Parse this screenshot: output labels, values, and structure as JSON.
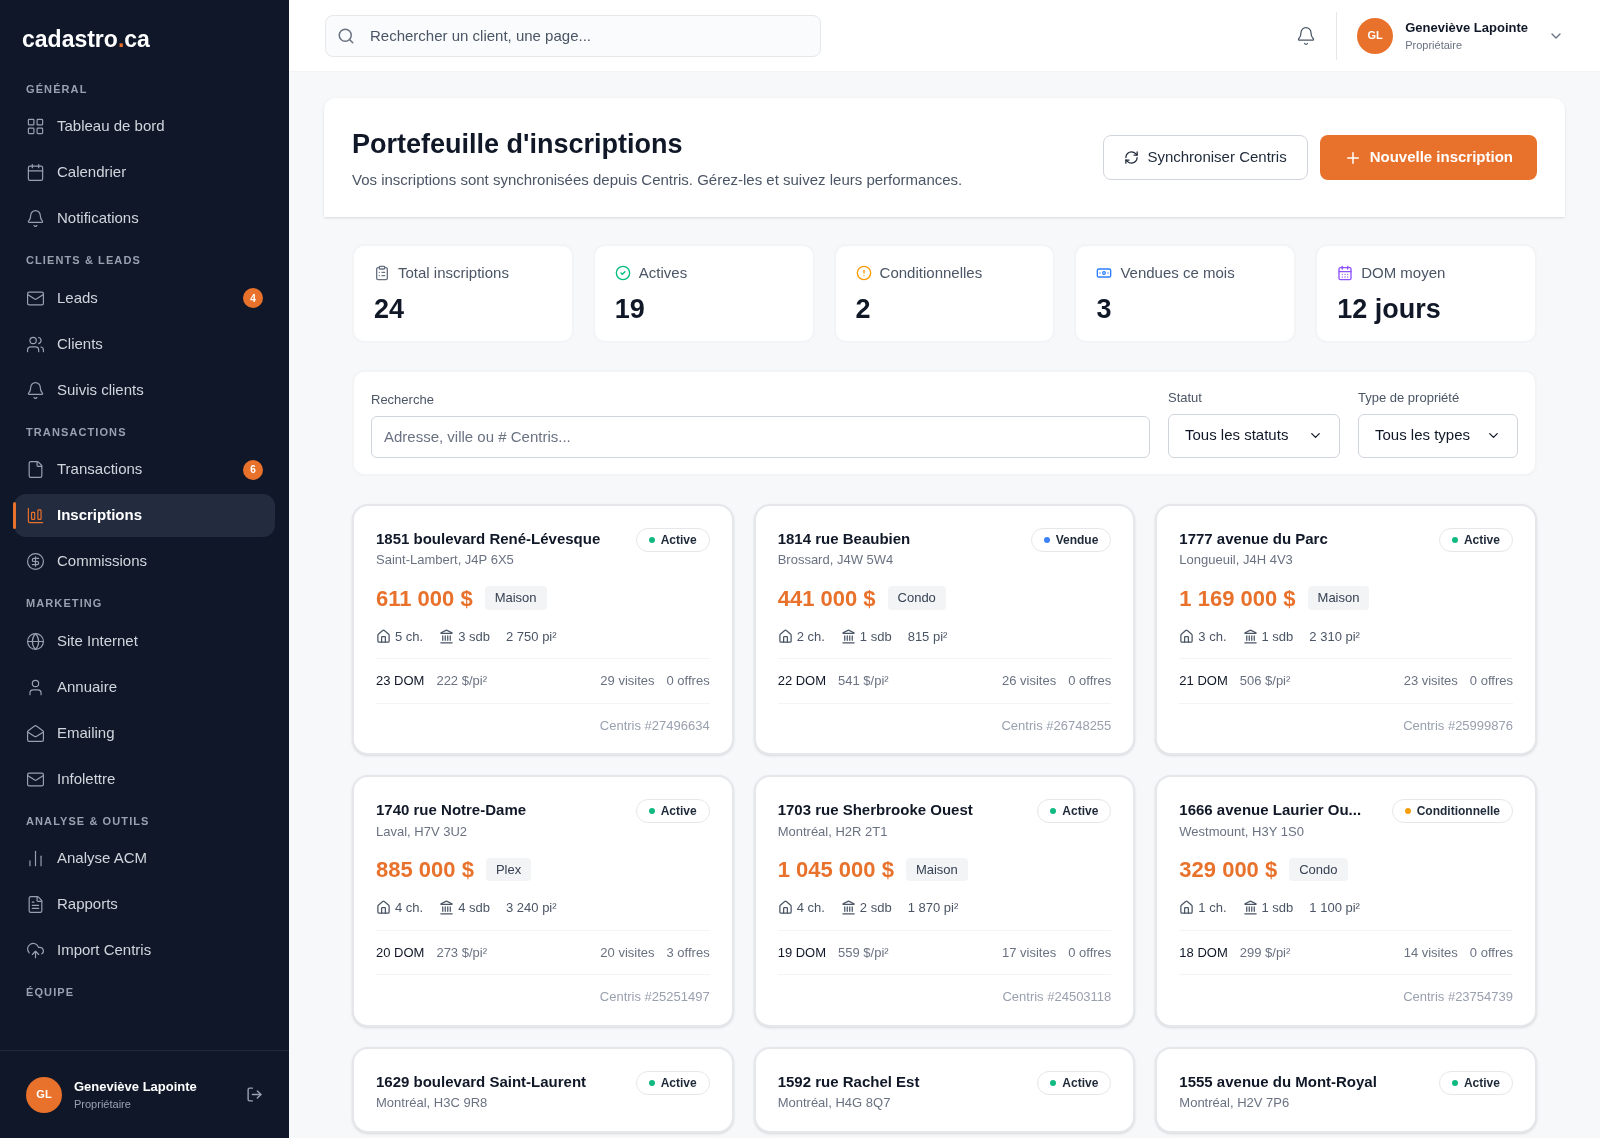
{
  "brand": {
    "name": "cadastro",
    "dot": ".",
    "tld": "ca"
  },
  "sidebar": {
    "sections": [
      {
        "title": "GÉNÉRAL",
        "items": [
          {
            "label": "Tableau de bord",
            "selected": false
          },
          {
            "label": "Calendrier",
            "selected": false
          },
          {
            "label": "Notifications",
            "selected": false
          }
        ]
      },
      {
        "title": "CLIENTS & LEADS",
        "items": [
          {
            "label": "Leads",
            "selected": false,
            "badge": "4"
          },
          {
            "label": "Clients",
            "selected": false
          },
          {
            "label": "Suivis clients",
            "selected": false
          }
        ]
      },
      {
        "title": "TRANSACTIONS",
        "items": [
          {
            "label": "Transactions",
            "selected": false,
            "badge": "6"
          },
          {
            "label": "Inscriptions",
            "selected": true
          },
          {
            "label": "Commissions",
            "selected": false
          }
        ]
      },
      {
        "title": "MARKETING",
        "items": [
          {
            "label": "Site Internet",
            "selected": false
          },
          {
            "label": "Annuaire",
            "selected": false
          },
          {
            "label": "Emailing",
            "selected": false
          },
          {
            "label": "Infolettre",
            "selected": false
          }
        ]
      },
      {
        "title": "ANALYSE & OUTILS",
        "items": [
          {
            "label": "Analyse ACM",
            "selected": false
          },
          {
            "label": "Rapports",
            "selected": false
          },
          {
            "label": "Import Centris",
            "selected": false
          }
        ]
      },
      {
        "title": "ÉQUIPE"
      }
    ],
    "user": {
      "initials": "GL",
      "name": "Geneviève Lapointe",
      "role": "Propriétaire"
    }
  },
  "topbar": {
    "search": {
      "placeholder": "Rechercher un client, une page..."
    },
    "user": {
      "initials": "GL",
      "name": "Geneviève Lapointe",
      "role": "Propriétaire"
    }
  },
  "header": {
    "title": "Portefeuille d'inscriptions",
    "subtitle": "Vos inscriptions sont synchronisées depuis Centris. Gérez-les et suivez leurs performances.",
    "buttons": [
      "Synchroniser Centris",
      "Nouvelle inscription"
    ]
  },
  "stats": [
    {
      "label": "Total inscriptions",
      "value": "24"
    },
    {
      "label": "Actives",
      "value": "19"
    },
    {
      "label": "Conditionnelles",
      "value": "2"
    },
    {
      "label": "Vendues ce mois",
      "value": "3"
    },
    {
      "label": "DOM moyen",
      "value": "12 jours"
    }
  ],
  "filters": {
    "search": {
      "label": "Recherche",
      "placeholder": "Adresse, ville ou # Centris..."
    },
    "status": {
      "label": "Statut",
      "value": "Tous les statuts"
    },
    "type": {
      "label": "Type de propriété",
      "value": "Tous les types"
    }
  },
  "listings": [
    {
      "address": "1851 boulevard René-Lévesque",
      "city": "Saint-Lambert, J4P 6X5",
      "status": "Active",
      "color": "#10b981",
      "price": "611 000 $",
      "type": "Maison",
      "beds": "5 ch.",
      "baths": "3 sdb",
      "area": "2 750 pi²",
      "dom": "23 DOM",
      "ppsf": "222 $/pi²",
      "visits": "29 visites",
      "offers": "0 offres",
      "centris": "Centris #27496634"
    },
    {
      "address": "1814 rue Beaubien",
      "city": "Brossard, J4W 5W4",
      "status": "Vendue",
      "color": "#3b82f6",
      "price": "441 000 $",
      "type": "Condo",
      "beds": "2 ch.",
      "baths": "1 sdb",
      "area": "815 pi²",
      "dom": "22 DOM",
      "ppsf": "541 $/pi²",
      "visits": "26 visites",
      "offers": "0 offres",
      "centris": "Centris #26748255"
    },
    {
      "address": "1777 avenue du Parc",
      "city": "Longueuil, J4H 4V3",
      "status": "Active",
      "color": "#10b981",
      "price": "1 169 000 $",
      "type": "Maison",
      "beds": "3 ch.",
      "baths": "1 sdb",
      "area": "2 310 pi²",
      "dom": "21 DOM",
      "ppsf": "506 $/pi²",
      "visits": "23 visites",
      "offers": "0 offres",
      "centris": "Centris #25999876"
    },
    {
      "address": "1740 rue Notre-Dame",
      "city": "Laval, H7V 3U2",
      "status": "Active",
      "color": "#10b981",
      "price": "885 000 $",
      "type": "Plex",
      "beds": "4 ch.",
      "baths": "4 sdb",
      "area": "3 240 pi²",
      "dom": "20 DOM",
      "ppsf": "273 $/pi²",
      "visits": "20 visites",
      "offers": "3 offres",
      "centris": "Centris #25251497"
    },
    {
      "address": "1703 rue Sherbrooke Ouest",
      "city": "Montréal, H2R 2T1",
      "status": "Active",
      "color": "#10b981",
      "price": "1 045 000 $",
      "type": "Maison",
      "beds": "4 ch.",
      "baths": "2 sdb",
      "area": "1 870 pi²",
      "dom": "19 DOM",
      "ppsf": "559 $/pi²",
      "visits": "17 visites",
      "offers": "0 offres",
      "centris": "Centris #24503118"
    },
    {
      "address": "1666 avenue Laurier Ou...",
      "city": "Westmount, H3Y 1S0",
      "status": "Conditionnelle",
      "color": "#f59e0b",
      "price": "329 000 $",
      "type": "Condo",
      "beds": "1 ch.",
      "baths": "1 sdb",
      "area": "1 100 pi²",
      "dom": "18 DOM",
      "ppsf": "299 $/pi²",
      "visits": "14 visites",
      "offers": "0 offres",
      "centris": "Centris #23754739"
    },
    {
      "address": "1629 boulevard Saint-Laurent",
      "city": "Montréal, H3C 9R8",
      "status": "Active",
      "color": "#10b981"
    },
    {
      "address": "1592 rue Rachel Est",
      "city": "Montréal, H4G 8Q7",
      "status": "Active",
      "color": "#10b981"
    },
    {
      "address": "1555 avenue du Mont-Royal",
      "city": "Montréal, H2V 7P6",
      "status": "Active",
      "color": "#10b981"
    }
  ]
}
